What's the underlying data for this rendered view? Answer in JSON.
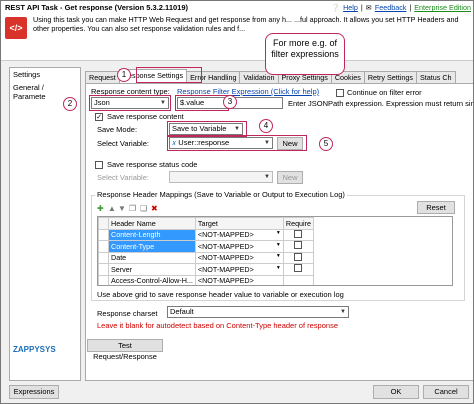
{
  "window": {
    "title": "REST API Task - Get response (Version 5.3.2.11019)",
    "links": {
      "help": "Help",
      "feedback": "Feedback",
      "edition": "Enterprise Edition"
    },
    "description": "Using this task you can make HTTP Web Request and get response from any h... ...ful approach. It allows you set HTTP Headers and other properties. You can also set response validation rules and f..."
  },
  "sidebar": {
    "items": [
      "Settings",
      "General / Paramete"
    ]
  },
  "tabs": [
    "Request",
    "Response Settings",
    "Error Handling",
    "Validation",
    "Proxy Settings",
    "Cookies",
    "Retry Settings",
    "Status Ch"
  ],
  "bubble": "For more e.g. of filter expressions",
  "callouts": [
    "1",
    "2",
    "3",
    "4",
    "5"
  ],
  "response": {
    "content_type_label": "Response content type:",
    "content_type_value": "Json",
    "filter_link": "Response Filter Expression (Click for help)",
    "filter_value": "$.value",
    "continue_on_error": "Continue on filter error",
    "filter_hint": "Enter JSONPath expression. Expression must return single o",
    "save_content_label": "Save response content",
    "save_mode_label": "Save Mode:",
    "save_mode_value": "Save to Variable",
    "select_variable_label": "Select Variable:",
    "variable_value": "User::response",
    "new_label": "New",
    "save_status_label": "Save response status code",
    "status_variable_label": "Select Variable:",
    "status_new_label": "New"
  },
  "mappings": {
    "title": "Response Header Mappings (Save to Variable or Output to Execution Log)",
    "reset_label": "Reset",
    "columns": [
      "Header Name",
      "Target",
      "Require"
    ],
    "rows": [
      {
        "name": "Content-Length",
        "target": "<NOT-MAPPED>"
      },
      {
        "name": "Content-Type",
        "target": "<NOT-MAPPED>"
      },
      {
        "name": "Date",
        "target": "<NOT-MAPPED>"
      },
      {
        "name": "Server",
        "target": "<NOT-MAPPED>"
      },
      {
        "name": "Access-Control-Allow-H...",
        "target": "<NOT-MAPPED>"
      }
    ],
    "hint": "Use above grid to save response header value to variable or execution log"
  },
  "charset": {
    "label": "Response charset",
    "value": "Default",
    "note": "Leave it blank for autodetect based on Content-Type header of response"
  },
  "buttons": {
    "test": "Test Request/Response",
    "expressions": "Expressions",
    "ok": "OK",
    "cancel": "Cancel"
  },
  "logo": "ZAPPYSYS",
  "colors": {
    "accent": "#c0285a",
    "selection": "#3399ff",
    "link": "#0645ad"
  }
}
